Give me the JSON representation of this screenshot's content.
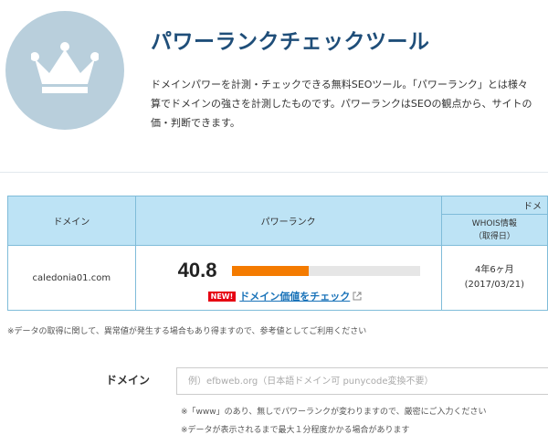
{
  "header": {
    "title": "パワーランクチェックツール",
    "description_lines": [
      "ドメインパワーを計測・チェックできる無料SEOツール。「パワーランク」とは様々",
      "算でドメインの強さを計測したものです。パワーランクはSEOの観点から、サイトの",
      "価・判断できます。"
    ],
    "logo_icon": "crown-icon"
  },
  "table": {
    "col_domain": "ドメイン",
    "col_power_rank": "パワーランク",
    "col_group_partial": "ドメ",
    "col_whois": "WHOIS情報",
    "col_whois_sub": "（取得日）",
    "row": {
      "domain": "caledonia01.com",
      "score": "40.8",
      "score_fraction": 0.408,
      "new_badge": "NEW!",
      "check_link": "ドメイン価値をチェック",
      "whois_age": "4年6ヶ月",
      "whois_date": "(2017/03/21)"
    }
  },
  "notes": {
    "data_disclaimer": "※データの取得に関して、異常値が発生する場合もあり得ますので、参考値としてご利用ください",
    "www_note": "※「www」のあり、無しでパワーランクが変わりますので、厳密にご入力ください",
    "display_time": "※データが表示されるまで最大１分程度かかる場合があります"
  },
  "form": {
    "label": "ドメイン",
    "placeholder": "例）efbweb.org（日本語ドメイン可 punycode変換不要）",
    "value": ""
  },
  "colors": {
    "title": "#1f4e79",
    "header_bg": "#bde3f5",
    "border": "#7fbcd9",
    "bar": "#f47b00",
    "badge": "#e60012",
    "link": "#1a73b9"
  }
}
